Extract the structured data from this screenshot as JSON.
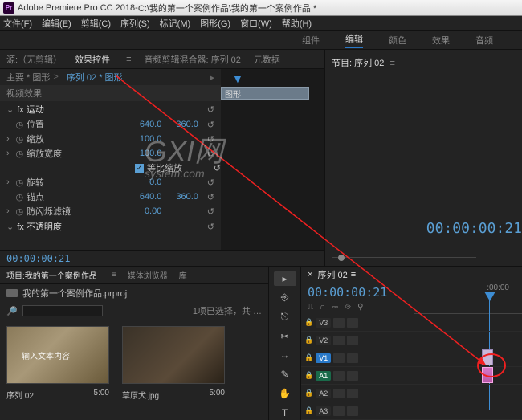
{
  "titlebar": {
    "app": "Adobe Premiere Pro CC 2018",
    "sep": " - ",
    "path": "C:\\我的第一个案例作品\\我的第一个案例作品 *"
  },
  "menu": {
    "file": "文件(F)",
    "edit": "编辑(E)",
    "clip": "剪辑(C)",
    "sequence": "序列(S)",
    "markers": "标记(M)",
    "graphics": "图形(G)",
    "window": "窗口(W)",
    "help": "帮助(H)"
  },
  "workspaces": {
    "assembly": "组件",
    "editing": "编辑",
    "color": "颜色",
    "effects": "效果",
    "audio": "音频"
  },
  "sourceTabs": {
    "source": "源:（无剪辑）",
    "effectControls": "效果控件",
    "audioMixer": "音频剪辑混合器: 序列 02",
    "metadata": "元数据"
  },
  "fxHeader": {
    "master": "主要 * 图形",
    "seqLink": "序列 02 * 图形"
  },
  "vh": "视频效果",
  "clipMini": "图形",
  "motion": {
    "title": "fx 运动",
    "position": {
      "label": "位置",
      "x": "640.0",
      "y": "360.0"
    },
    "scale": {
      "label": "缩放",
      "v": "100.0"
    },
    "scaleW": {
      "label": "缩放宽度",
      "v": "100.0"
    },
    "uniform": "等比缩放",
    "rotation": {
      "label": "旋转",
      "v": "0.0"
    },
    "anchor": {
      "label": "锚点",
      "x": "640.0",
      "y": "360.0"
    },
    "antiflicker": {
      "label": "防闪烁滤镜",
      "v": "0.00"
    }
  },
  "opacity": "fx 不透明度",
  "tcLeft": "00:00:00:21",
  "programTabs": "节目: 序列 02",
  "programTC": "00:00:00:21",
  "project": {
    "tabs": {
      "project": "项目:我的第一个案例作品",
      "mediaBrowser": "媒体浏览器",
      "libraries": "库"
    },
    "bin": "我的第一个案例作品.prproj",
    "selected": "1项已选择，共 …",
    "thumb1": {
      "overlay": "输入文本内容",
      "name": "序列 02",
      "dur": "5:00"
    },
    "thumb2": {
      "name": "草原犬.jpg",
      "dur": "5:00"
    }
  },
  "tools": {
    "sel": "▸",
    "track": "⎆",
    "ripple": "⎋",
    "razor": "✂",
    "slip": "↔",
    "pen": "✎",
    "hand": "✋",
    "type": "T"
  },
  "timeline": {
    "tab": "序列 02",
    "tc": "00:00:00:21",
    "rulerTick": ":00:00",
    "tracks": {
      "v3": "V3",
      "v2": "V2",
      "v1": "V1",
      "a1": "A1",
      "a2": "A2",
      "a3": "A3"
    }
  },
  "watermark": {
    "main": "GXI网",
    "sub": "system.com"
  }
}
